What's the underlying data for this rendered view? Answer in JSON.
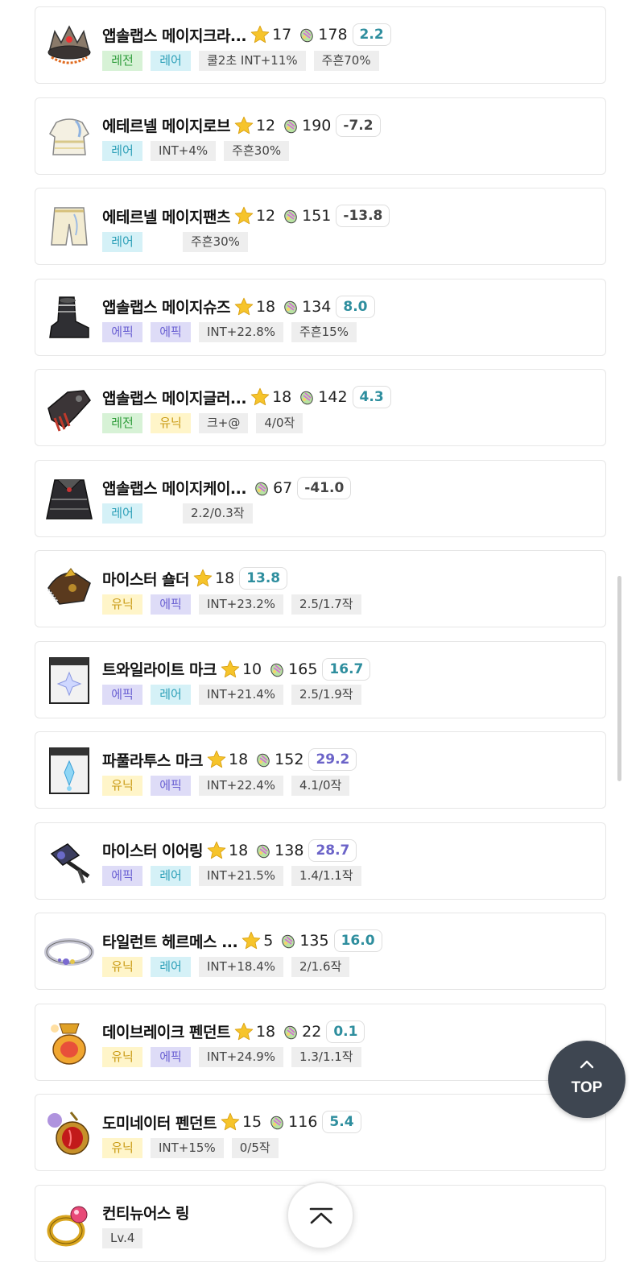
{
  "items": [
    {
      "name": "앱솔랩스 메이지크라...",
      "star": "17",
      "gem": "178",
      "score": "2.2",
      "score_type": "pos",
      "icon": "crown-helmet-icon",
      "tags": [
        {
          "text": "레전",
          "cls": "legend"
        },
        {
          "text": "레어",
          "cls": "rare"
        },
        {
          "text": "쿨2초 INT+11%",
          "cls": "stat"
        },
        {
          "text": "주흔70%",
          "cls": "stat"
        }
      ]
    },
    {
      "name": "에테르넬 메이지로브",
      "star": "12",
      "gem": "190",
      "score": "-7.2",
      "score_type": "neg",
      "icon": "robe-icon",
      "tags": [
        {
          "text": "레어",
          "cls": "rare"
        },
        {
          "text": "INT+4%",
          "cls": "stat"
        },
        {
          "text": "주흔30%",
          "cls": "stat"
        }
      ]
    },
    {
      "name": "에테르넬 메이지팬츠",
      "star": "12",
      "gem": "151",
      "score": "-13.8",
      "score_type": "neg",
      "icon": "pants-icon",
      "tags": [
        {
          "text": "레어",
          "cls": "rare"
        },
        {
          "text": "",
          "cls": "empty"
        },
        {
          "text": "주흔30%",
          "cls": "stat"
        }
      ]
    },
    {
      "name": "앱솔랩스 메이지슈즈",
      "star": "18",
      "gem": "134",
      "score": "8.0",
      "score_type": "pos",
      "icon": "shoes-icon",
      "tags": [
        {
          "text": "에픽",
          "cls": "epic"
        },
        {
          "text": "에픽",
          "cls": "epic"
        },
        {
          "text": "INT+22.8%",
          "cls": "stat"
        },
        {
          "text": "주흔15%",
          "cls": "stat"
        }
      ]
    },
    {
      "name": "앱솔랩스 메이지글러...",
      "star": "18",
      "gem": "142",
      "score": "4.3",
      "score_type": "pos",
      "icon": "glove-icon",
      "tags": [
        {
          "text": "레전",
          "cls": "legend"
        },
        {
          "text": "유닉",
          "cls": "unique"
        },
        {
          "text": "크+@",
          "cls": "stat"
        },
        {
          "text": "4/0작",
          "cls": "stat"
        }
      ]
    },
    {
      "name": "앱솔랩스 메이지케이...",
      "star": "",
      "gem": "67",
      "score": "-41.0",
      "score_type": "neg",
      "icon": "cape-icon",
      "tags": [
        {
          "text": "레어",
          "cls": "rare"
        },
        {
          "text": "",
          "cls": "empty"
        },
        {
          "text": "2.2/0.3작",
          "cls": "stat"
        }
      ]
    },
    {
      "name": "마이스터 숄더",
      "star": "18",
      "gem": "",
      "score": "13.8",
      "score_type": "pos",
      "icon": "shoulder-icon",
      "tags": [
        {
          "text": "유닉",
          "cls": "unique"
        },
        {
          "text": "에픽",
          "cls": "epic"
        },
        {
          "text": "INT+23.2%",
          "cls": "stat"
        },
        {
          "text": "2.5/1.7작",
          "cls": "stat"
        }
      ]
    },
    {
      "name": "트와일라이트 마크",
      "star": "10",
      "gem": "165",
      "score": "16.7",
      "score_type": "pos",
      "icon": "mark-sparkle-icon",
      "tags": [
        {
          "text": "에픽",
          "cls": "epic"
        },
        {
          "text": "레어",
          "cls": "rare"
        },
        {
          "text": "INT+21.4%",
          "cls": "stat"
        },
        {
          "text": "2.5/1.9작",
          "cls": "stat"
        }
      ]
    },
    {
      "name": "파풀라투스 마크",
      "star": "18",
      "gem": "152",
      "score": "29.2",
      "score_type": "high",
      "icon": "mark-crystal-icon",
      "tags": [
        {
          "text": "유닉",
          "cls": "unique"
        },
        {
          "text": "에픽",
          "cls": "epic"
        },
        {
          "text": "INT+22.4%",
          "cls": "stat"
        },
        {
          "text": "4.1/0작",
          "cls": "stat"
        }
      ]
    },
    {
      "name": "마이스터 이어링",
      "star": "18",
      "gem": "138",
      "score": "28.7",
      "score_type": "high",
      "icon": "earring-icon",
      "tags": [
        {
          "text": "에픽",
          "cls": "epic"
        },
        {
          "text": "레어",
          "cls": "rare"
        },
        {
          "text": "INT+21.5%",
          "cls": "stat"
        },
        {
          "text": "1.4/1.1작",
          "cls": "stat"
        }
      ]
    },
    {
      "name": "타일런트 헤르메스 ...",
      "star": "5",
      "gem": "135",
      "score": "16.0",
      "score_type": "pos",
      "icon": "belt-icon",
      "tags": [
        {
          "text": "유닉",
          "cls": "unique"
        },
        {
          "text": "레어",
          "cls": "rare"
        },
        {
          "text": "INT+18.4%",
          "cls": "stat"
        },
        {
          "text": "2/1.6작",
          "cls": "stat"
        }
      ]
    },
    {
      "name": "데이브레이크 펜던트",
      "star": "18",
      "gem": "22",
      "score": "0.1",
      "score_type": "pos",
      "icon": "pendant-gold-icon",
      "tags": [
        {
          "text": "유닉",
          "cls": "unique"
        },
        {
          "text": "에픽",
          "cls": "epic"
        },
        {
          "text": "INT+24.9%",
          "cls": "stat"
        },
        {
          "text": "1.3/1.1작",
          "cls": "stat"
        }
      ]
    },
    {
      "name": "도미네이터 펜던트",
      "star": "15",
      "gem": "116",
      "score": "5.4",
      "score_type": "pos",
      "icon": "pendant-red-icon",
      "tags": [
        {
          "text": "유닉",
          "cls": "unique"
        },
        {
          "text": "INT+15%",
          "cls": "stat"
        },
        {
          "text": "0/5작",
          "cls": "stat"
        }
      ]
    },
    {
      "name": "컨티뉴어스 링",
      "star": "",
      "gem": "",
      "score": "",
      "score_type": "",
      "icon": "ring-icon",
      "tags": [
        {
          "text": "Lv.4",
          "cls": "stat"
        }
      ]
    }
  ],
  "top_button": {
    "label": "TOP"
  },
  "colors": {
    "legend": "#2f9d3b",
    "rare": "#2ea0b8",
    "epic": "#6b61d3",
    "unique": "#c99a14",
    "score_pos": "#2e8e9e",
    "score_high": "#6b63c8"
  }
}
